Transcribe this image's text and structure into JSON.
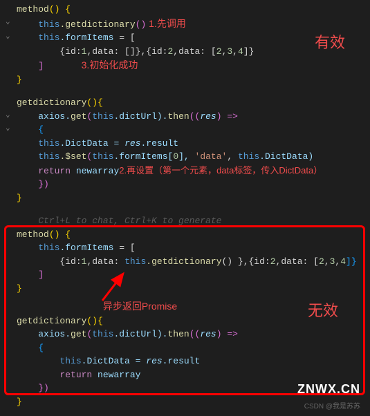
{
  "block1": {
    "l1_fn": "method",
    "l1_p": "() {",
    "l2_this": "this",
    "l2_fn": ".getdictionary",
    "l2_p": "()",
    "l2_ann": " 1.先调用",
    "l3_this": "this",
    "l3_var": ".formItems",
    "l3_p": " = [",
    "l4_a": "{id:",
    "l4_n1": "1",
    "l4_b": ",data: [",
    "l4_c": "]},{id:",
    "l4_n2": "2",
    "l4_d": ",data: [",
    "l4_n3": "2",
    "l4_n4": "3",
    "l4_n5": "4",
    "l4_e": "]}",
    "l5_p": "]",
    "l5_ann": "3.初始化成功",
    "l6_p": "}",
    "side_ann": "有效"
  },
  "block2": {
    "l1_fn": "getdictionary",
    "l1_p": "(){",
    "l2_a": "axios.",
    "l2_fn": "get",
    "l2_b": "(",
    "l2_this": "this",
    "l2_c": ".dictUrl).",
    "l2_fn2": "then",
    "l2_d": "((",
    "l2_res": "res",
    "l2_e": ") =>",
    "l3_p": "{",
    "l4_this": "this",
    "l4_a": ".DictData = ",
    "l4_res": "res",
    "l4_b": ".result",
    "l5_this": "this",
    "l5_fn": ".$set",
    "l5_a": "(",
    "l5_this2": "this",
    "l5_b": ".formItems[",
    "l5_n": "0",
    "l5_c": "], ",
    "l5_str": "'data'",
    "l5_d": ", ",
    "l5_this3": "this",
    "l5_e": ".DictData)",
    "l6_kw": "return",
    "l6_var": " newarray",
    "l6_ann": "2.再设置（第一个元素，data标签，传入DictData）",
    "l7_p": "})",
    "l8_p": "}"
  },
  "ghost_hint": "Ctrl+L to chat, Ctrl+K to generate",
  "block3": {
    "l1_fn": "method",
    "l1_p": "() {",
    "l2_this": "this",
    "l2_var": ".formItems",
    "l2_p": " = [",
    "l3_a": "{id:",
    "l3_n1": "1",
    "l3_b": ",data: ",
    "l3_this": "this",
    "l3_fn": ".getdictionary",
    "l3_c": "() },{id:",
    "l3_n2": "2",
    "l3_d": ",data: [",
    "l3_n3": "2",
    "l3_n4": "3",
    "l3_n5": "4",
    "l3_e": "]}",
    "l4_p": "]",
    "l5_p": "}",
    "arrow_ann": "异步返回Promise",
    "side_ann": "无效"
  },
  "block4": {
    "l1_fn": "getdictionary",
    "l1_p": "(){",
    "l2_a": "axios.",
    "l2_fn": "get",
    "l2_b": "(",
    "l2_this": "this",
    "l2_c": ".dictUrl).",
    "l2_fn2": "then",
    "l2_d": "((",
    "l2_res": "res",
    "l2_e": ") =>",
    "l3_p": "{",
    "l4_this": "this",
    "l4_a": ".DictData = ",
    "l4_res": "res",
    "l4_b": ".result",
    "l5_kw": "return",
    "l5_var": " newarray",
    "l6_p": "})",
    "l7_p": "}"
  },
  "watermark": "ZNWX.CN",
  "credit": "CSDN @我是苏苏"
}
